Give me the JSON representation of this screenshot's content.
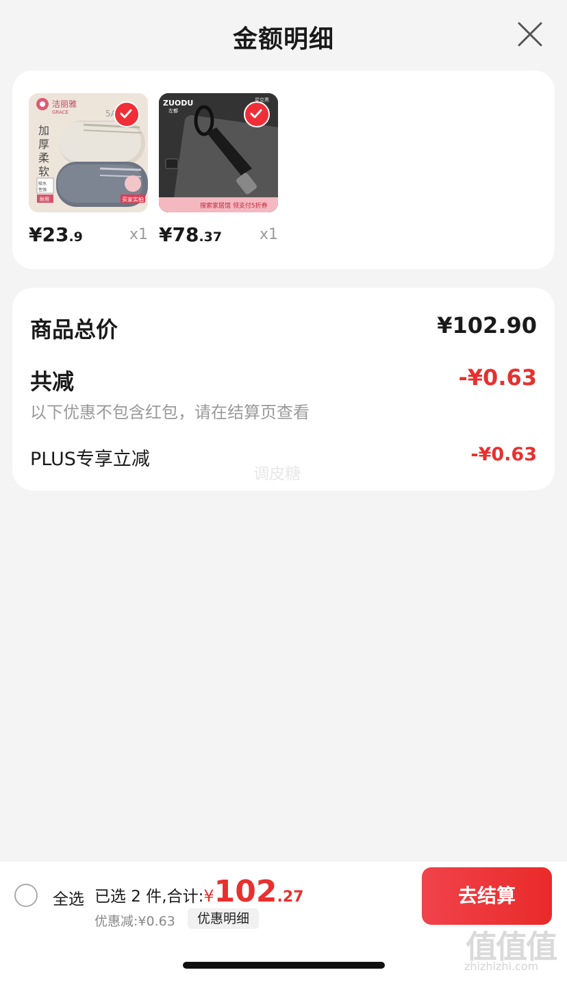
{
  "header": {
    "title": "金额明细"
  },
  "products": [
    {
      "price_int": "¥23",
      "price_dec": ".9",
      "qty": "x1",
      "image": {
        "brand_cn": "洁丽雅",
        "brand_en": "GRACE",
        "tag": "5A",
        "text": "加厚柔软",
        "sub1": "吸水性强",
        "sub2": "耐用",
        "badge": "买家实拍"
      }
    },
    {
      "price_int": "¥78",
      "price_dec": ".37",
      "qty": "x1",
      "image": {
        "brand_en": "ZUODU",
        "brand_cn": "左都",
        "color": "星空黑",
        "banner": "搜索家居馆 领支付5折券"
      }
    }
  ],
  "summary": {
    "total_label": "商品总价",
    "total_value": "¥102.90",
    "reduce_label": "共减",
    "reduce_value": "-¥0.63",
    "note": "以下优惠不包含红包，请在结算页查看",
    "plus_label": "PLUS专享立减",
    "plus_value": "-¥0.63",
    "watermark": "调皮糖"
  },
  "bottom_bar": {
    "select_all": "全选",
    "selected_text": "已选 2 件,合计:",
    "total_symbol": "¥",
    "total_int": "102",
    "total_dec": ".27",
    "discount": "优惠减:¥0.63",
    "discount_detail": "优惠明细",
    "checkout": "去结算"
  },
  "site": {
    "logo": "值值值",
    "url": "zhizhizhi.com"
  },
  "colors": {
    "accent": "#e8302e",
    "check": "#f02e38"
  }
}
